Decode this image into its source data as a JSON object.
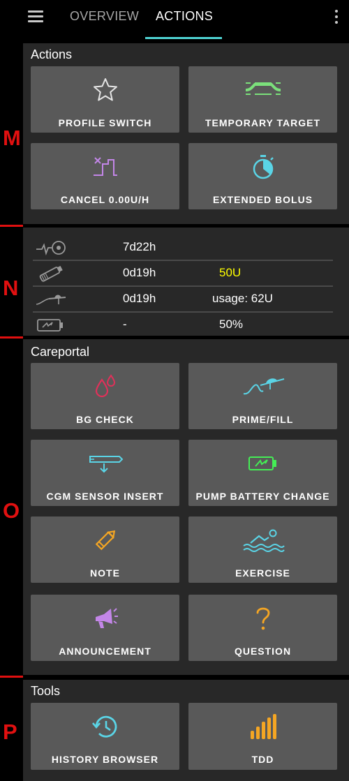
{
  "tabs": {
    "overview": "OVERVIEW",
    "actions": "ACTIONS"
  },
  "side_labels": {
    "m": "M",
    "n": "N",
    "o": "O",
    "p": "P"
  },
  "colors": {
    "accent": "#4fd3d3",
    "reservoir": "#ffff00",
    "marker": "#e01010"
  },
  "actions": {
    "title": "Actions",
    "buttons": [
      {
        "label": "PROFILE SWITCH",
        "icon": "star-icon"
      },
      {
        "label": "TEMPORARY TARGET",
        "icon": "temp-target-icon"
      },
      {
        "label": "CANCEL 0.00U/H",
        "icon": "cancel-temp-basal-icon"
      },
      {
        "label": "EXTENDED BOLUS",
        "icon": "stopwatch-icon"
      }
    ]
  },
  "status": {
    "rows": [
      {
        "icon": "cannula-age-icon",
        "age": "7d22h",
        "value": ""
      },
      {
        "icon": "insulin-pen-icon",
        "age": "0d19h",
        "value": "50U"
      },
      {
        "icon": "cannula-icon",
        "age": "0d19h",
        "value": "usage: 62U"
      },
      {
        "icon": "pump-battery-icon",
        "age": "-",
        "value": "50%"
      }
    ]
  },
  "careportal": {
    "title": "Careportal",
    "buttons": [
      {
        "label": "BG CHECK",
        "icon": "blood-drops-icon"
      },
      {
        "label": "PRIME/FILL",
        "icon": "cannula-prime-icon"
      },
      {
        "label": "CGM SENSOR INSERT",
        "icon": "cgm-sensor-icon"
      },
      {
        "label": "PUMP BATTERY CHANGE",
        "icon": "battery-charging-icon"
      },
      {
        "label": "NOTE",
        "icon": "pencil-icon"
      },
      {
        "label": "EXERCISE",
        "icon": "swimmer-icon"
      },
      {
        "label": "ANNOUNCEMENT",
        "icon": "megaphone-icon"
      },
      {
        "label": "QUESTION",
        "icon": "question-mark-icon"
      }
    ]
  },
  "tools": {
    "title": "Tools",
    "buttons": [
      {
        "label": "HISTORY BROWSER",
        "icon": "history-icon"
      },
      {
        "label": "TDD",
        "icon": "bar-chart-icon"
      }
    ]
  }
}
